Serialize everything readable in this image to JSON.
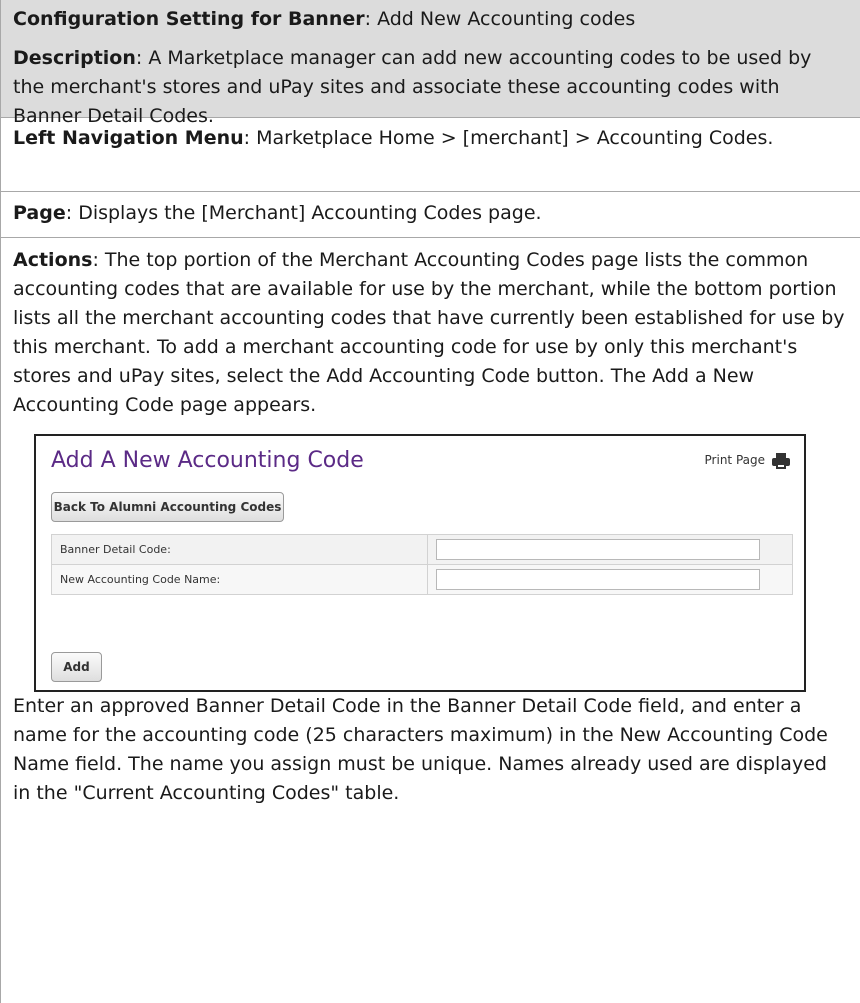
{
  "config": {
    "label": "Configuration Setting for Banner",
    "value": "Add New Accounting codes"
  },
  "description": {
    "label": "Description",
    "text": "A Marketplace manager can add new accounting codes to be used by the merchant's stores and uPay sites and associate these accounting codes with Banner Detail Codes."
  },
  "left_nav": {
    "label": "Left Navigation Menu",
    "text": "Marketplace Home > [merchant] > Accounting Codes."
  },
  "page": {
    "label": "Page",
    "text": "Displays the [Merchant] Accounting Codes page."
  },
  "actions": {
    "label": "Actions",
    "text": "The top portion of the Merchant Accounting Codes page lists the common accounting codes that are available for use by the merchant, while the bottom portion lists all the merchant accounting codes that have currently been established for use by this merchant. To add a merchant accounting code for use by only this merchant's stores and uPay sites, select the Add Accounting Code button. The Add a New Accounting Code page appears.",
    "followup": "Enter an approved Banner Detail Code in the Banner Detail Code field, and enter a name for the accounting code (25 characters maximum) in the New Accounting Code Name field. The name you assign must be unique. Names already used are displayed in the \"Current Accounting Codes\" table."
  },
  "screenshot": {
    "title": "Add A New Accounting Code",
    "print_label": "Print Page",
    "print_icon": "printer-icon",
    "back_button": "Back To Alumni Accounting Codes",
    "fields": [
      {
        "label": "Banner Detail Code:",
        "value": ""
      },
      {
        "label": "New Accounting Code Name:",
        "value": ""
      }
    ],
    "add_button": "Add"
  }
}
